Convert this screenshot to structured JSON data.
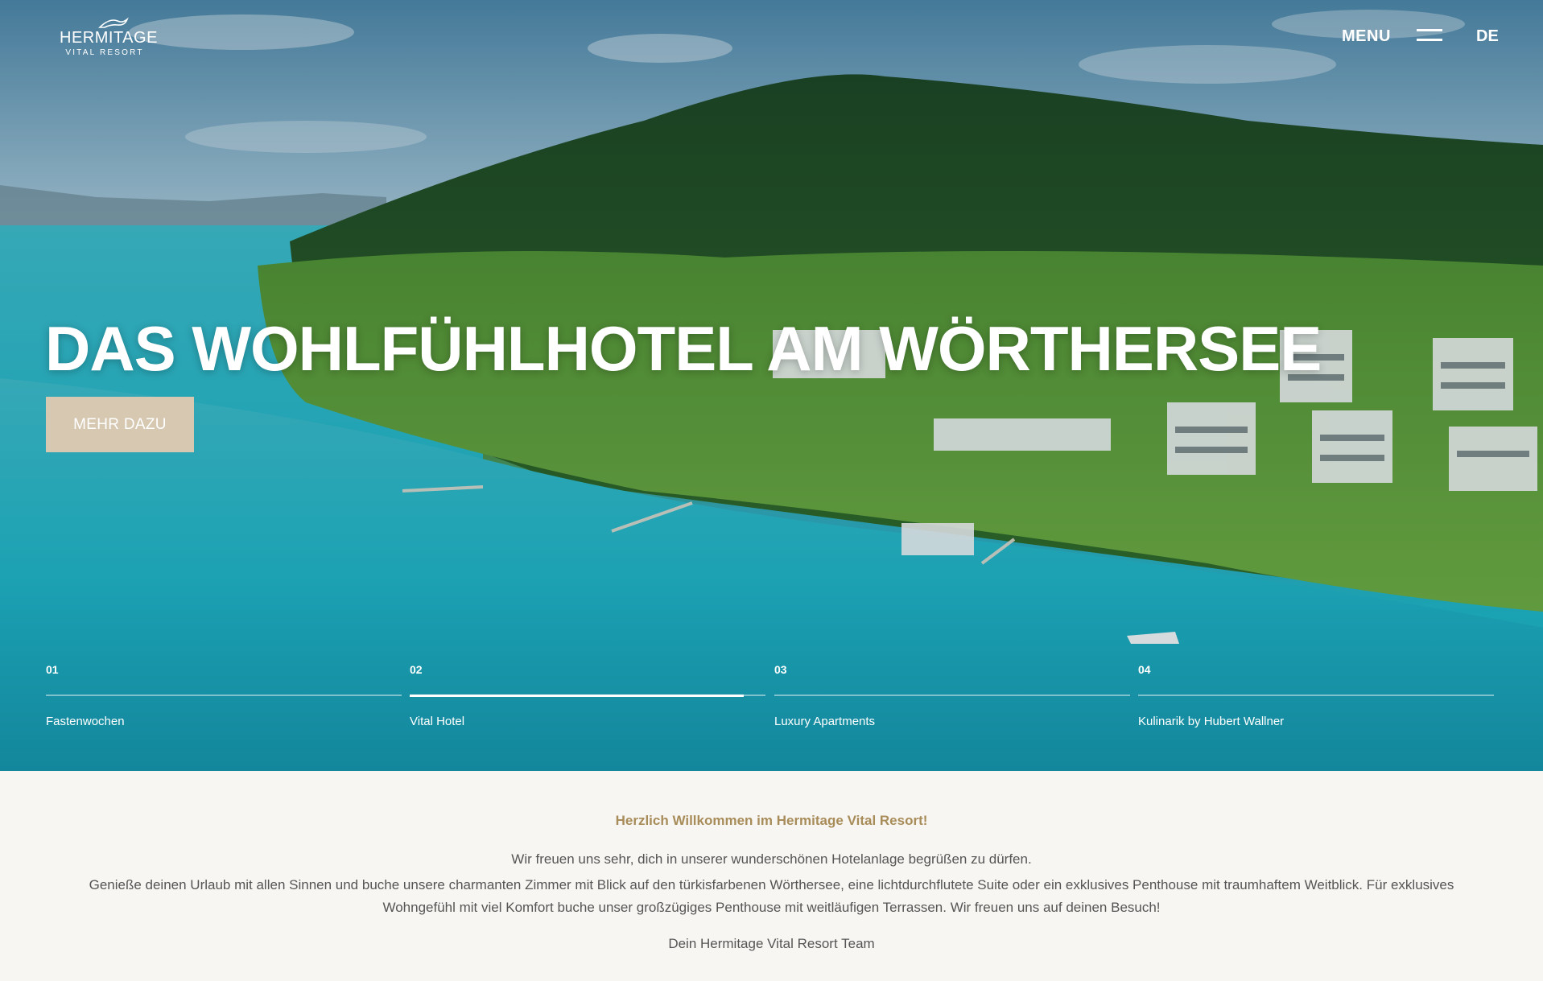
{
  "header": {
    "logo_name": "HERMITAGE",
    "logo_sub": "VITAL RESORT",
    "menu_label": "MENU",
    "language": "DE"
  },
  "hero": {
    "headline": "DAS WOHLFÜHLHOTEL AM WÖRTHERSEE",
    "cta_label": "MEHR DAZU",
    "slides": [
      {
        "number": "01",
        "title": "Fastenwochen",
        "progress": 0
      },
      {
        "number": "02",
        "title": "Vital Hotel",
        "progress": 0.94
      },
      {
        "number": "03",
        "title": "Luxury Apartments",
        "progress": 0
      },
      {
        "number": "04",
        "title": "Kulinarik by Hubert Wallner",
        "progress": 0
      }
    ]
  },
  "intro": {
    "heading": "Herzlich Willkommen im Hermitage Vital Resort!",
    "paragraph_1": "Wir freuen uns sehr, dich in unserer wunderschönen Hotelanlage begrüßen zu dürfen.",
    "paragraph_2": "Genieße deinen Urlaub mit allen Sinnen und buche unsere charmanten Zimmer mit Blick auf den türkisfarbenen Wörthersee, eine lichtdurchflutete Suite oder ein exklusives Penthouse mit traumhaftem Weitblick. Für exklusives Wohngefühl mit viel Komfort buche unser großzügiges Penthouse mit weitläufigen Terrassen. Wir freuen uns auf deinen Besuch!",
    "signature": "Dein Hermitage Vital Resort Team"
  },
  "colors": {
    "accent_gold": "#a88c5a",
    "button_beige": "#d6c8b1",
    "background": "#f8f6f2",
    "lake_turquoise": "#1db1c3"
  }
}
